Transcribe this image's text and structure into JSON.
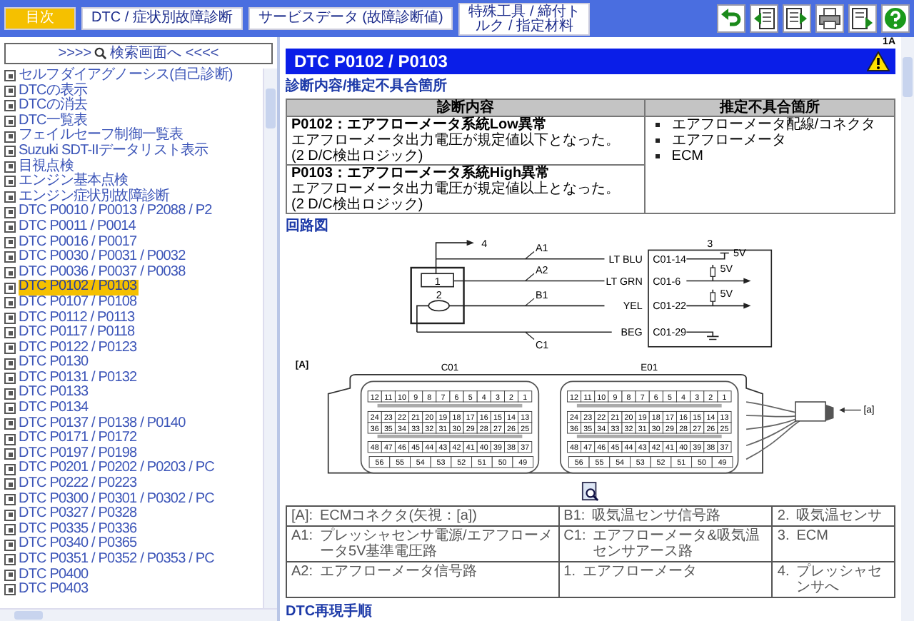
{
  "toolbar": {
    "tabs": [
      {
        "label": "目次",
        "selected": true
      },
      {
        "label": "DTC / 症状別故障診断",
        "selected": false
      },
      {
        "label": "サービスデータ (故障診断値)",
        "selected": false
      },
      {
        "label": "特殊工具 / 締付トルク / 指定材料",
        "selected": false
      }
    ]
  },
  "sidebar": {
    "search_button": {
      "before": ">>>>",
      "after": "検索画面へ <<<<"
    },
    "items": [
      {
        "label": "セルフダイアグノーシス(自己診断)",
        "selected": false
      },
      {
        "label": "DTCの表示",
        "selected": false
      },
      {
        "label": "DTCの消去",
        "selected": false
      },
      {
        "label": "DTC一覧表",
        "selected": false
      },
      {
        "label": "フェイルセーフ制御一覧表",
        "selected": false
      },
      {
        "label": "Suzuki SDT-IIデータリスト表示",
        "selected": false
      },
      {
        "label": "目視点検",
        "selected": false
      },
      {
        "label": "エンジン基本点検",
        "selected": false
      },
      {
        "label": "エンジン症状別故障診断",
        "selected": false
      },
      {
        "label": "DTC P0010 / P0013 / P2088 / P2",
        "selected": false
      },
      {
        "label": "DTC P0011 / P0014",
        "selected": false
      },
      {
        "label": "DTC P0016 / P0017",
        "selected": false
      },
      {
        "label": "DTC P0030 / P0031 / P0032",
        "selected": false
      },
      {
        "label": "DTC P0036 / P0037 / P0038",
        "selected": false
      },
      {
        "label": "DTC P0102 / P0103",
        "selected": true
      },
      {
        "label": "DTC P0107 / P0108",
        "selected": false
      },
      {
        "label": "DTC P0112 / P0113",
        "selected": false
      },
      {
        "label": "DTC P0117 / P0118",
        "selected": false
      },
      {
        "label": "DTC P0122 / P0123",
        "selected": false
      },
      {
        "label": "DTC P0130",
        "selected": false
      },
      {
        "label": "DTC P0131 / P0132",
        "selected": false
      },
      {
        "label": "DTC P0133",
        "selected": false
      },
      {
        "label": "DTC P0134",
        "selected": false
      },
      {
        "label": "DTC P0137 / P0138 / P0140",
        "selected": false
      },
      {
        "label": "DTC P0171 / P0172",
        "selected": false
      },
      {
        "label": "DTC P0197 / P0198",
        "selected": false
      },
      {
        "label": "DTC P0201 / P0202 / P0203 / PC",
        "selected": false
      },
      {
        "label": "DTC P0222 / P0223",
        "selected": false
      },
      {
        "label": "DTC P0300 / P0301 / P0302 / PC",
        "selected": false
      },
      {
        "label": "DTC P0327 / P0328",
        "selected": false
      },
      {
        "label": "DTC P0335 / P0336",
        "selected": false
      },
      {
        "label": "DTC P0340 / P0365",
        "selected": false
      },
      {
        "label": "DTC P0351 / P0352 / P0353 / PC",
        "selected": false
      },
      {
        "label": "DTC P0400",
        "selected": false
      },
      {
        "label": "DTC P0403",
        "selected": false
      }
    ]
  },
  "page": {
    "code_label": "1A",
    "title": "DTC P0102 / P0103",
    "diagnosis": {
      "heading": "診断内容/推定不具合箇所",
      "columns": [
        "診断内容",
        "推定不具合箇所"
      ],
      "conditions": [
        {
          "title": "P0102：エアフローメータ系統Low異常",
          "lines": [
            "エアフローメータ出力電圧が規定値以下となった。",
            "(2 D/C検出ロジック)"
          ]
        },
        {
          "title": "P0103：エアフローメータ系統High異常",
          "lines": [
            "エアフローメータ出力電圧が規定値以上となった。",
            "(2 D/C検出ロジック)"
          ]
        }
      ],
      "causes": [
        "エアフローメータ配線/コネクタ",
        "エアフローメータ",
        "ECM"
      ]
    },
    "circuit": {
      "heading": "回路図",
      "sensor_labels": [
        "1",
        "2"
      ],
      "ecm_label": "3",
      "destination_label": "4",
      "wires": [
        {
          "name": "A1",
          "wire_color": "LT BLU",
          "pin": "C01-14",
          "kind": "supply",
          "voltage": "5V"
        },
        {
          "name": "A2",
          "wire_color": "LT GRN",
          "pin": "C01-6",
          "kind": "signal",
          "voltage": "5V"
        },
        {
          "name": "B1",
          "wire_color": "YEL",
          "pin": "C01-22",
          "kind": "signal",
          "voltage": "5V"
        },
        {
          "name": "C1",
          "wire_color": "BEG",
          "pin": "C01-29",
          "kind": "ground"
        }
      ]
    },
    "connector": {
      "view_label": "[A]",
      "harness_label": "[a]",
      "blocks": [
        {
          "label": "C01",
          "rows": [
            [
              "12",
              "11",
              "10",
              "9",
              "8",
              "7",
              "6",
              "5",
              "4",
              "3",
              "2",
              "1"
            ],
            [
              "24",
              "23",
              "22",
              "21",
              "20",
              "19",
              "18",
              "17",
              "16",
              "15",
              "14",
              "13"
            ],
            [
              "36",
              "35",
              "34",
              "33",
              "32",
              "31",
              "30",
              "29",
              "28",
              "27",
              "26",
              "25"
            ],
            [
              "48",
              "47",
              "46",
              "45",
              "44",
              "43",
              "42",
              "41",
              "40",
              "39",
              "38",
              "37"
            ]
          ],
          "bottom_row": [
            "56",
            "55",
            "54",
            "53",
            "52",
            "51",
            "50",
            "49"
          ]
        },
        {
          "label": "E01",
          "rows": [
            [
              "12",
              "11",
              "10",
              "9",
              "8",
              "7",
              "6",
              "5",
              "4",
              "3",
              "2",
              "1"
            ],
            [
              "24",
              "23",
              "22",
              "21",
              "20",
              "19",
              "18",
              "17",
              "16",
              "15",
              "14",
              "13"
            ],
            [
              "36",
              "35",
              "34",
              "33",
              "32",
              "31",
              "30",
              "29",
              "28",
              "27",
              "26",
              "25"
            ],
            [
              "48",
              "47",
              "46",
              "45",
              "44",
              "43",
              "42",
              "41",
              "40",
              "39",
              "38",
              "37"
            ]
          ],
          "bottom_row": [
            "56",
            "55",
            "54",
            "53",
            "52",
            "51",
            "50",
            "49"
          ]
        }
      ]
    },
    "legend": [
      [
        {
          "key": "[A]:",
          "text": "ECMコネクタ(矢視：[a])"
        },
        {
          "key": "B1:",
          "text": "吸気温センサ信号路"
        },
        {
          "key": "2.",
          "text": "吸気温センサ"
        }
      ],
      [
        {
          "key": "A1:",
          "text": "プレッシャセンサ電源/エアフローメータ5V基準電圧路"
        },
        {
          "key": "C1:",
          "text": "エアフローメータ&吸気温センサアース路"
        },
        {
          "key": "3.",
          "text": "ECM"
        }
      ],
      [
        {
          "key": "A2:",
          "text": "エアフローメータ信号路"
        },
        {
          "key": "1.",
          "text": "エアフローメータ"
        },
        {
          "key": "4.",
          "text": "プレッシャセンサへ"
        }
      ]
    ],
    "next_heading": "DTC再現手順"
  }
}
